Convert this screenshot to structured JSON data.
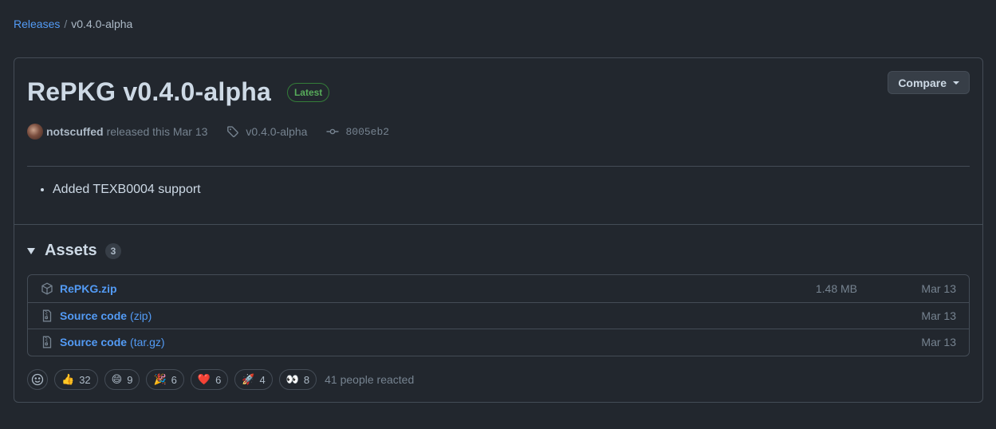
{
  "breadcrumb": {
    "releases_label": "Releases",
    "separator": "/",
    "current": "v0.4.0-alpha"
  },
  "release": {
    "title": "RePKG v0.4.0-alpha",
    "badge": "Latest",
    "compare_label": "Compare",
    "author": "notscuffed",
    "released_text": "released this Mar 13",
    "tag": "v0.4.0-alpha",
    "commit": "8005eb2",
    "notes": [
      "Added TEXB0004 support"
    ]
  },
  "assets": {
    "title": "Assets",
    "count": "3",
    "items": [
      {
        "name": "RePKG.zip",
        "ext": "",
        "size": "1.48 MB",
        "date": "Mar 13",
        "icon": "package-icon"
      },
      {
        "name": "Source code",
        "ext": "(zip)",
        "size": "",
        "date": "Mar 13",
        "icon": "file-zip-icon"
      },
      {
        "name": "Source code",
        "ext": "(tar.gz)",
        "size": "",
        "date": "Mar 13",
        "icon": "file-zip-icon"
      }
    ]
  },
  "reactions": {
    "items": [
      {
        "emoji": "👍",
        "count": "32"
      },
      {
        "emoji": "😄",
        "count": "9"
      },
      {
        "emoji": "🎉",
        "count": "6"
      },
      {
        "emoji": "❤️",
        "count": "6"
      },
      {
        "emoji": "🚀",
        "count": "4"
      },
      {
        "emoji": "👀",
        "count": "8"
      }
    ],
    "summary": "41 people reacted"
  },
  "colors": {
    "background": "#22272e",
    "border": "#444c56",
    "link": "#539bf5",
    "latest_green": "#57ab5a"
  }
}
